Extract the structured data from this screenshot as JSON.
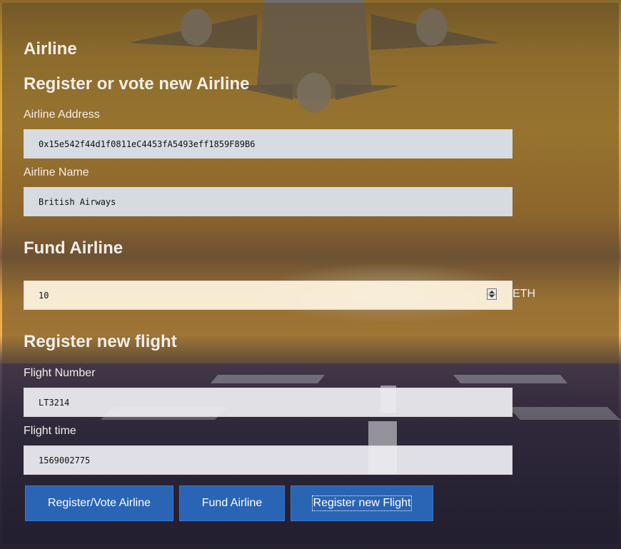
{
  "app": {
    "title": "Airline"
  },
  "register_section": {
    "heading": "Register or vote new Airline",
    "address_label": "Airline Address",
    "address_value": "0x15e542f44d1f0811eC4453fA5493eff1859F89B6",
    "name_label": "Airline Name",
    "name_value": "British Airways"
  },
  "fund_section": {
    "heading": "Fund Airline",
    "amount_value": "10",
    "unit": "ETH"
  },
  "flight_section": {
    "heading": "Register new flight",
    "number_label": "Flight Number",
    "number_value": "LT3214",
    "time_label": "Flight time",
    "time_value": "1569002775"
  },
  "buttons": {
    "register_vote": "Register/Vote Airline",
    "fund": "Fund Airline",
    "register_flight": "Register new Flight"
  },
  "colors": {
    "button": "#2a64b4",
    "heading_text": "#f2eee8"
  },
  "icons": {
    "spinner": "number-spinner-icon"
  }
}
